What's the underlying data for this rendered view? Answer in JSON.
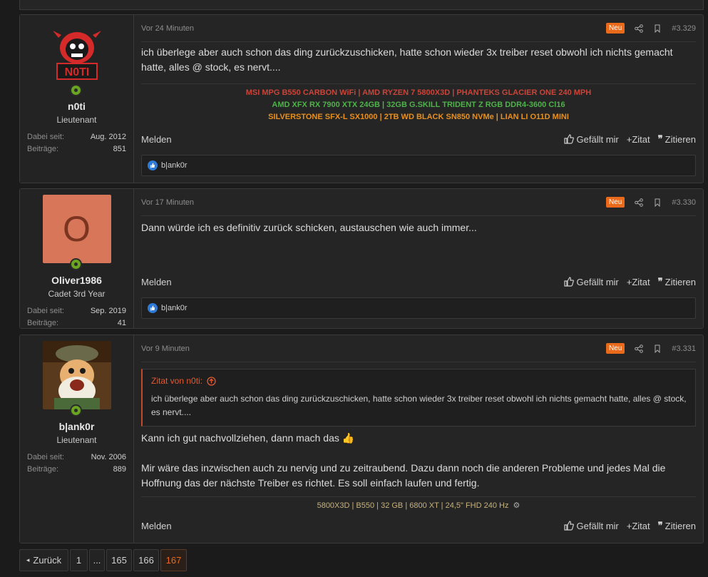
{
  "posts": [
    {
      "user": {
        "name": "n0ti",
        "title": "Lieutenant",
        "since_label": "Dabei seit:",
        "since": "Aug. 2012",
        "posts_label": "Beiträge:",
        "posts": "851",
        "logo_text": "N0TI"
      },
      "time": "Vor 24 Minuten",
      "badge": "Neu",
      "number": "#3.329",
      "text": "ich überlege aber auch schon das ding zurückzuschicken, hatte schon wieder 3x treiber reset obwohl ich nichts gemacht hatte, alles @ stock, es nervt....",
      "signature": [
        {
          "text": "MSI MPG B550 CARBON WiFi | AMD RYZEN 7 5800X3D | PHANTEKS GLACIER ONE 240 MPH",
          "color": "#c8453a"
        },
        {
          "text": "AMD XFX RX 7900 XTX 24GB | 32GB G.SKILL TRIDENT Z RGB DDR4-3600 Cl16",
          "color": "#4fb24a"
        },
        {
          "text": "SILVERSTONE SFX-L SX1000 | 2TB WD BLACK SN850 NVMe | LIAN LI O11D MINI",
          "color": "#e8901e"
        }
      ],
      "reaction": "b|ank0r"
    },
    {
      "user": {
        "name": "Oliver1986",
        "title": "Cadet 3rd Year",
        "since_label": "Dabei seit:",
        "since": "Sep. 2019",
        "posts_label": "Beiträge:",
        "posts": "41",
        "initial": "O"
      },
      "time": "Vor 17 Minuten",
      "badge": "Neu",
      "number": "#3.330",
      "text": "Dann würde ich es definitiv zurück schicken, austauschen wie auch immer...",
      "reaction": "b|ank0r"
    },
    {
      "user": {
        "name": "b|ank0r",
        "title": "Lieutenant",
        "since_label": "Dabei seit:",
        "since": "Nov. 2006",
        "posts_label": "Beiträge:",
        "posts": "889"
      },
      "time": "Vor 9 Minuten",
      "badge": "Neu",
      "number": "#3.331",
      "quote_head": "Zitat von n0ti:",
      "quote_text": "ich überlege aber auch schon das ding zurückzuschicken, hatte schon wieder 3x treiber reset obwohl ich nichts gemacht hatte, alles @ stock, es nervt....",
      "text1": "Kann ich gut nachvollziehen, dann mach das 👍",
      "text2": "Mir wäre das inzwischen auch zu nervig und zu zeitraubend. Dazu dann noch die anderen Probleme und jedes Mal die Hoffnung das der nächste Treiber es richtet. Es soll einfach laufen und fertig.",
      "signature": "5800X3D | B550 | 32 GB | 6800 XT | 24,5\" FHD 240 Hz"
    }
  ],
  "actions": {
    "report": "Melden",
    "like": "Gefällt mir",
    "quote": "Zitat",
    "reply_quote": "Zitieren"
  },
  "pager": {
    "back": "Zurück",
    "pages": [
      "1",
      "...",
      "165",
      "166",
      "167"
    ],
    "current": "167"
  },
  "colors": {
    "accent": "#e86a1a",
    "online": "#6aa51f",
    "like": "#2e7ad6"
  }
}
